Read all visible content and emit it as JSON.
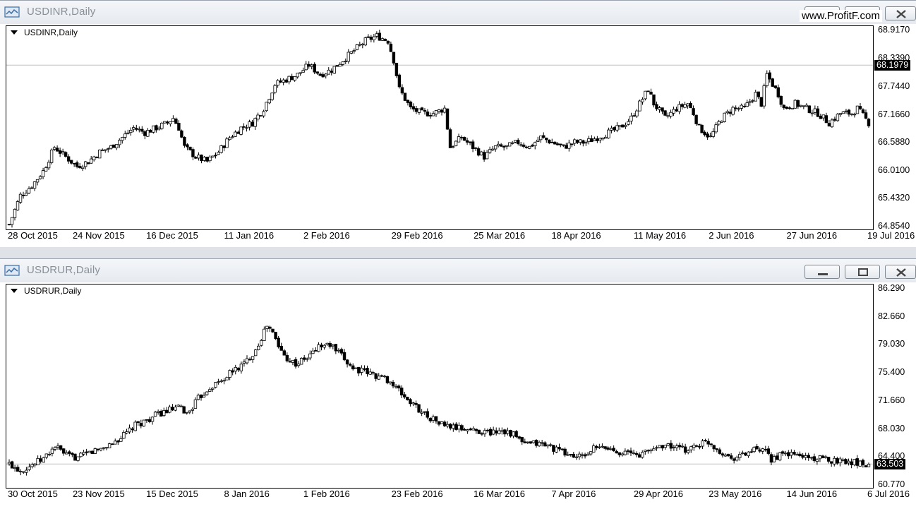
{
  "watermark": "www.ProfitF.com",
  "colors": {
    "bull": "#ffffff",
    "bear": "#000000",
    "outline": "#000000",
    "grid_line": "#c0c0c0"
  },
  "windows": [
    {
      "title": "USDINR,Daily",
      "chart_label": "USDINR,Daily",
      "icons": {
        "app": "chart-window-icon",
        "minimize": "minimize-icon",
        "maximize": "maximize-icon",
        "close": "close-icon"
      },
      "current_price_label": "68.1979",
      "chart_data": {
        "type": "candlestick",
        "symbol": "USDINR",
        "timeframe": "Daily",
        "ylim": [
          64.854,
          68.917
        ],
        "current_price": 68.1979,
        "yticks": [
          "68.9170",
          "68.3390",
          "67.7440",
          "67.1660",
          "66.5880",
          "66.0100",
          "65.4320",
          "64.8540"
        ],
        "xticks": [
          "28 Oct 2015",
          "24 Nov 2015",
          "16 Dec 2015",
          "11 Jan 2016",
          "2 Feb 2016",
          "29 Feb 2016",
          "25 Mar 2016",
          "18 Apr 2016",
          "11 May 2016",
          "2 Jun 2016",
          "27 Jun 2016",
          "19 Jul 2016"
        ],
        "close_path": [
          [
            0,
            64.9
          ],
          [
            4,
            65.5
          ],
          [
            8,
            65.7
          ],
          [
            12,
            66.0
          ],
          [
            16,
            66.5
          ],
          [
            20,
            66.3
          ],
          [
            24,
            66.1
          ],
          [
            28,
            66.2
          ],
          [
            32,
            66.4
          ],
          [
            36,
            66.5
          ],
          [
            40,
            66.7
          ],
          [
            44,
            66.9
          ],
          [
            48,
            66.8
          ],
          [
            52,
            66.9
          ],
          [
            56,
            67.0
          ],
          [
            58,
            67.1
          ],
          [
            60,
            66.9
          ],
          [
            62,
            66.5
          ],
          [
            66,
            66.3
          ],
          [
            70,
            66.2
          ],
          [
            74,
            66.4
          ],
          [
            78,
            66.7
          ],
          [
            82,
            66.9
          ],
          [
            86,
            67.0
          ],
          [
            90,
            67.3
          ],
          [
            94,
            67.8
          ],
          [
            98,
            67.9
          ],
          [
            102,
            68.0
          ],
          [
            106,
            68.2
          ],
          [
            110,
            68.0
          ],
          [
            114,
            68.1
          ],
          [
            118,
            68.3
          ],
          [
            122,
            68.5
          ],
          [
            126,
            68.7
          ],
          [
            130,
            68.8
          ],
          [
            134,
            68.7
          ],
          [
            136,
            68.3
          ],
          [
            138,
            67.7
          ],
          [
            142,
            67.3
          ],
          [
            146,
            67.2
          ],
          [
            150,
            67.2
          ],
          [
            154,
            67.3
          ],
          [
            156,
            66.5
          ],
          [
            160,
            66.7
          ],
          [
            164,
            66.5
          ],
          [
            168,
            66.3
          ],
          [
            172,
            66.5
          ],
          [
            176,
            66.5
          ],
          [
            180,
            66.6
          ],
          [
            184,
            66.5
          ],
          [
            188,
            66.7
          ],
          [
            192,
            66.6
          ],
          [
            196,
            66.5
          ],
          [
            200,
            66.6
          ],
          [
            204,
            66.6
          ],
          [
            208,
            66.7
          ],
          [
            212,
            66.8
          ],
          [
            216,
            66.9
          ],
          [
            220,
            67.1
          ],
          [
            224,
            67.5
          ],
          [
            226,
            67.7
          ],
          [
            228,
            67.4
          ],
          [
            232,
            67.1
          ],
          [
            236,
            67.3
          ],
          [
            240,
            67.4
          ],
          [
            242,
            67.2
          ],
          [
            244,
            66.9
          ],
          [
            248,
            66.7
          ],
          [
            252,
            67.1
          ],
          [
            256,
            67.3
          ],
          [
            260,
            67.3
          ],
          [
            264,
            67.6
          ],
          [
            266,
            67.4
          ],
          [
            268,
            68.0
          ],
          [
            270,
            67.8
          ],
          [
            272,
            67.6
          ],
          [
            274,
            67.3
          ],
          [
            278,
            67.4
          ],
          [
            282,
            67.3
          ],
          [
            286,
            67.2
          ],
          [
            290,
            67.0
          ],
          [
            294,
            67.2
          ],
          [
            298,
            67.2
          ],
          [
            300,
            67.3
          ],
          [
            304,
            67.0
          ]
        ]
      },
      "x_ticks": [
        "28 Oct 2015",
        "24 Nov 2015",
        "16 Dec 2015",
        "11 Jan 2016",
        "2 Feb 2016",
        "29 Feb 2016",
        "25 Mar 2016",
        "18 Apr 2016",
        "11 May 2016",
        "2 Jun 2016",
        "27 Jun 2016",
        "19 Jul 2016"
      ],
      "y_ticks": [
        "68.9170",
        "68.3390",
        "67.7440",
        "67.1660",
        "66.5880",
        "66.0100",
        "65.4320",
        "64.8540"
      ]
    },
    {
      "title": "USDRUR,Daily",
      "chart_label": "USDRUR,Daily",
      "icons": {
        "app": "chart-window-icon",
        "minimize": "minimize-icon",
        "maximize": "maximize-icon",
        "close": "close-icon"
      },
      "current_price_label": "63.503",
      "chart_data": {
        "type": "candlestick",
        "symbol": "USDRUR",
        "timeframe": "Daily",
        "ylim": [
          60.77,
          86.29
        ],
        "current_price": 63.503,
        "yticks": [
          "86.290",
          "82.660",
          "79.030",
          "75.400",
          "71.660",
          "68.030",
          "64.400",
          "60.770"
        ],
        "xticks": [
          "30 Oct 2015",
          "23 Nov 2015",
          "15 Dec 2015",
          "8 Jan 2016",
          "1 Feb 2016",
          "23 Feb 2016",
          "16 Mar 2016",
          "7 Apr 2016",
          "29 Apr 2016",
          "23 May 2016",
          "14 Jun 2016",
          "6 Jul 2016"
        ],
        "close_path": [
          [
            0,
            63.5
          ],
          [
            4,
            62.7
          ],
          [
            8,
            63.4
          ],
          [
            12,
            64.2
          ],
          [
            16,
            65.8
          ],
          [
            20,
            64.6
          ],
          [
            24,
            64.3
          ],
          [
            28,
            65.0
          ],
          [
            32,
            65.5
          ],
          [
            36,
            66.2
          ],
          [
            40,
            67.2
          ],
          [
            44,
            68.5
          ],
          [
            48,
            69.2
          ],
          [
            52,
            70.0
          ],
          [
            56,
            70.5
          ],
          [
            60,
            70.8
          ],
          [
            62,
            70.0
          ],
          [
            66,
            72.0
          ],
          [
            70,
            73.5
          ],
          [
            74,
            74.3
          ],
          [
            78,
            75.6
          ],
          [
            82,
            76.5
          ],
          [
            86,
            78.4
          ],
          [
            90,
            81.5
          ],
          [
            92,
            80.5
          ],
          [
            94,
            78.8
          ],
          [
            96,
            77.6
          ],
          [
            100,
            76.5
          ],
          [
            104,
            77.3
          ],
          [
            108,
            78.8
          ],
          [
            112,
            79.0
          ],
          [
            116,
            77.5
          ],
          [
            120,
            76.0
          ],
          [
            124,
            75.5
          ],
          [
            128,
            75.0
          ],
          [
            132,
            74.5
          ],
          [
            136,
            73.0
          ],
          [
            140,
            71.5
          ],
          [
            144,
            70.3
          ],
          [
            148,
            69.3
          ],
          [
            152,
            68.5
          ],
          [
            156,
            68.2
          ],
          [
            160,
            68.0
          ],
          [
            164,
            67.8
          ],
          [
            168,
            67.6
          ],
          [
            172,
            68.0
          ],
          [
            176,
            67.3
          ],
          [
            180,
            66.0
          ],
          [
            184,
            66.2
          ],
          [
            188,
            65.9
          ],
          [
            192,
            65.2
          ],
          [
            196,
            64.6
          ],
          [
            200,
            64.4
          ],
          [
            204,
            65.5
          ],
          [
            208,
            65.6
          ],
          [
            212,
            65.2
          ],
          [
            216,
            64.9
          ],
          [
            220,
            64.7
          ],
          [
            224,
            65.4
          ],
          [
            228,
            66.0
          ],
          [
            232,
            65.7
          ],
          [
            236,
            65.3
          ],
          [
            240,
            66.0
          ],
          [
            244,
            66.4
          ],
          [
            248,
            65.2
          ],
          [
            252,
            64.3
          ],
          [
            256,
            64.7
          ],
          [
            260,
            65.3
          ],
          [
            264,
            65.0
          ],
          [
            266,
            64.1
          ],
          [
            268,
            64.5
          ],
          [
            272,
            64.8
          ],
          [
            276,
            64.6
          ],
          [
            280,
            64.3
          ],
          [
            284,
            64.1
          ],
          [
            288,
            64.0
          ],
          [
            292,
            63.9
          ],
          [
            296,
            63.7
          ],
          [
            300,
            63.5
          ]
        ]
      },
      "x_ticks": [
        "30 Oct 2015",
        "23 Nov 2015",
        "15 Dec 2015",
        "8 Jan 2016",
        "1 Feb 2016",
        "23 Feb 2016",
        "16 Mar 2016",
        "7 Apr 2016",
        "29 Apr 2016",
        "23 May 2016",
        "14 Jun 2016",
        "6 Jul 2016"
      ],
      "y_ticks": [
        "86.290",
        "82.660",
        "79.030",
        "75.400",
        "71.660",
        "68.030",
        "64.400",
        "60.770"
      ]
    }
  ]
}
